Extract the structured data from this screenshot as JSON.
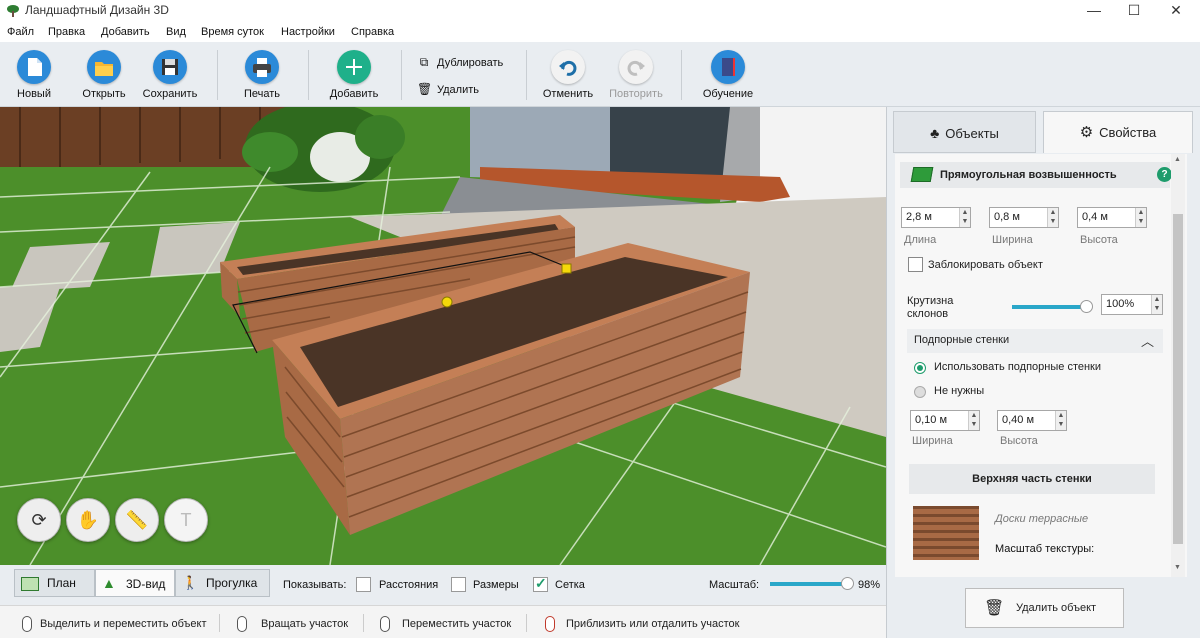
{
  "window": {
    "title": "Ландшафтный Дизайн 3D",
    "minimize": "—",
    "maximize": "☐",
    "close": "✕"
  },
  "menu": [
    "Файл",
    "Правка",
    "Добавить",
    "Вид",
    "Время суток",
    "Настройки",
    "Справка"
  ],
  "toolbar": {
    "new": "Новый",
    "open": "Открыть",
    "save": "Сохранить",
    "print": "Печать",
    "add": "Добавить",
    "duplicate": "Дублировать",
    "delete": "Удалить",
    "undo": "Отменить",
    "redo": "Повторить",
    "learn": "Обучение"
  },
  "viewport": {
    "text_tool": "T"
  },
  "bottombar": {
    "plan": "План",
    "view3d": "3D-вид",
    "walk": "Прогулка",
    "show_label": "Показывать:",
    "distances": "Расстояния",
    "sizes": "Размеры",
    "grid": "Сетка",
    "distances_checked": false,
    "sizes_checked": false,
    "grid_checked": true,
    "scale_label": "Масштаб:",
    "scale_value": "98%",
    "scale_fraction": 0.98
  },
  "statusbar": {
    "select_move": "Выделить и переместить объект",
    "rotate": "Вращать участок",
    "move": "Переместить участок",
    "zoom": "Приблизить или отдалить участок"
  },
  "panel": {
    "tab_objects": "Объекты",
    "tab_properties": "Свойства",
    "object_name": "Прямоугольная возвышенность",
    "help": "?",
    "length_value": "2,8 м",
    "length_label": "Длина",
    "width_value": "0,8 м",
    "width_label": "Ширина",
    "height_value": "0,4 м",
    "height_label": "Высота",
    "lock_label": "Заблокировать объект",
    "slope_label_1": "Крутизна",
    "slope_label_2": "склонов",
    "slope_value": "100%",
    "slope_fraction": 1.0,
    "retaining_section": "Подпорные стенки",
    "use_walls": "Использовать подпорные стенки",
    "no_walls": "Не нужны",
    "wall_width_value": "0,10 м",
    "wall_width_label": "Ширина",
    "wall_height_value": "0,40 м",
    "wall_height_label": "Высота",
    "top_section": "Верхняя часть стенки",
    "texture_name": "Доски террасные",
    "texture_scale": "Масштаб текстуры:",
    "delete_button": "Удалить объект"
  },
  "colors": {
    "accent": "#1e9c6c",
    "toolbar_bg": "#e9edf1",
    "grass": "#4c8f2a",
    "wood": "#a86a45",
    "soil": "#4a3426"
  }
}
